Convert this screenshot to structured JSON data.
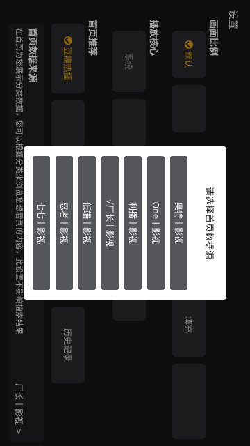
{
  "page": {
    "title": "设置"
  },
  "aspect_ratio": {
    "title": "画面比例",
    "options": [
      "默认",
      "",
      "",
      "",
      "填充",
      ""
    ],
    "selected": "默认"
  },
  "player_core": {
    "title": "播放核心",
    "options": [
      "系统",
      "",
      ""
    ]
  },
  "home_recommend": {
    "title": "首页推荐",
    "options": [
      "豆瓣热播",
      "",
      "",
      "",
      "历史记录"
    ],
    "selected": "豆瓣热播"
  },
  "home_source": {
    "title": "首页数据来源",
    "description": "在首页为您展示分类数据，您可以根据分类来浏览您想看到的内容，此设置不影响搜索结果",
    "current_value": "厂长丨影视 >"
  },
  "dialog": {
    "title": "请选择首页数据源",
    "options": [
      "奥特丨影视",
      "One丨影视",
      "利播丨影视",
      "√厂长丨影视",
      "低端丨影视",
      "忍者丨影视",
      "七七丨影视"
    ]
  },
  "colors": {
    "accent": "#e0a020",
    "background": "#161616",
    "card": "#2c2c2f",
    "dialog_option": "#55565c"
  }
}
